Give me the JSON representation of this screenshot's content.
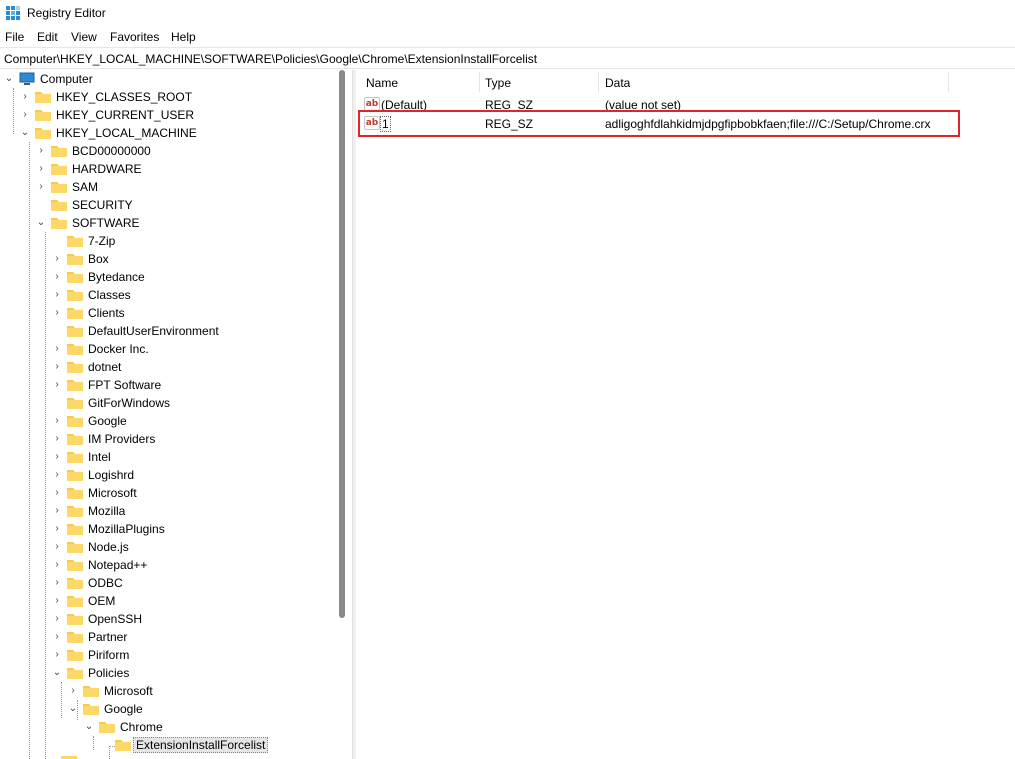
{
  "window": {
    "title": "Registry Editor"
  },
  "menu": [
    "File",
    "Edit",
    "View",
    "Favorites",
    "Help"
  ],
  "address": "Computer\\HKEY_LOCAL_MACHINE\\SOFTWARE\\Policies\\Google\\Chrome\\ExtensionInstallForcelist",
  "tree": {
    "root": "Computer",
    "hkcr": "HKEY_CLASSES_ROOT",
    "hkcu": "HKEY_CURRENT_USER",
    "hklm": "HKEY_LOCAL_MACHINE",
    "hklm_children": [
      "BCD00000000",
      "HARDWARE",
      "SAM",
      "SECURITY",
      "SOFTWARE"
    ],
    "software_children": [
      "7-Zip",
      "Box",
      "Bytedance",
      "Classes",
      "Clients",
      "DefaultUserEnvironment",
      "Docker Inc.",
      "dotnet",
      "FPT Software",
      "GitForWindows",
      "Google",
      "IM Providers",
      "Intel",
      "Logishrd",
      "Microsoft",
      "Mozilla",
      "MozillaPlugins",
      "Node.js",
      "Notepad++",
      "ODBC",
      "OEM",
      "OpenSSH",
      "Partner",
      "Piriform",
      "Policies"
    ],
    "policies_children": [
      "Microsoft",
      "Google"
    ],
    "google_child": "Chrome",
    "chrome_child": "ExtensionInstallForcelist"
  },
  "list": {
    "columns": [
      "Name",
      "Type",
      "Data"
    ],
    "icon_text": "ab",
    "rows": [
      {
        "name": "(Default)",
        "type": "REG_SZ",
        "data": "(value not set)"
      },
      {
        "name": "1",
        "type": "REG_SZ",
        "data": "adligoghfdlahkidmjdpgfipbobkfaen;file:///C:/Setup/Chrome.crx"
      }
    ]
  },
  "colors": {
    "highlight": "#e0242c",
    "folder": "#f8c84a",
    "computer": "#2a8ad4"
  }
}
